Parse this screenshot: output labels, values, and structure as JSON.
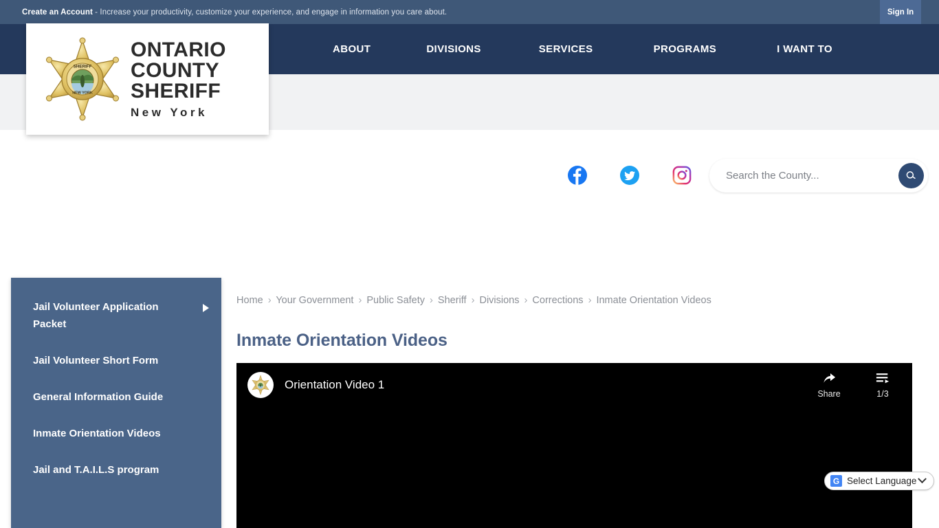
{
  "top_banner": {
    "create_account_label": "Create an Account",
    "tagline": " - Increase your productivity, customize your experience, and engage in information you care about.",
    "sign_in_label": "Sign In",
    "bg_color": "#3f5878",
    "sign_in_bg_color": "#4d6a95"
  },
  "logo": {
    "line1": "ONTARIO",
    "line2": "COUNTY",
    "line3": "SHERIFF",
    "line4": "New York",
    "badge_alt": "sheriff-star-badge",
    "badge_color": "#d9b44a"
  },
  "nav": {
    "bg_color": "#24395c",
    "items": [
      {
        "label": "ABOUT",
        "name": "nav-item-about"
      },
      {
        "label": "DIVISIONS",
        "name": "nav-item-divisions"
      },
      {
        "label": "SERVICES",
        "name": "nav-item-services"
      },
      {
        "label": "PROGRAMS",
        "name": "nav-item-programs"
      },
      {
        "label": "I WANT TO",
        "name": "nav-item-i-want-to"
      }
    ]
  },
  "utility": {
    "bg_color": "#f1f2f3",
    "social": [
      {
        "name": "facebook-icon",
        "label": "Facebook",
        "color": "#1877f2"
      },
      {
        "name": "twitter-icon",
        "label": "Twitter",
        "color": "#1da1f2"
      },
      {
        "name": "instagram-icon",
        "label": "Instagram",
        "color": "#e1306c"
      }
    ],
    "search": {
      "placeholder": "Search the County...",
      "value": "",
      "button_icon": "search-icon",
      "button_color": "#2f4a73"
    }
  },
  "sidebar": {
    "bg_color": "#4a6589",
    "items": [
      {
        "label": "Jail Volunteer Application Packet",
        "has_submenu": true
      },
      {
        "label": "Jail Volunteer Short Form",
        "has_submenu": false
      },
      {
        "label": "General Information Guide",
        "has_submenu": false
      },
      {
        "label": "Inmate Orientation Videos",
        "has_submenu": false
      },
      {
        "label": "Jail and T.A.I.L.S program",
        "has_submenu": false
      }
    ]
  },
  "breadcrumb": [
    "Home",
    "Your Government",
    "Public Safety",
    "Sheriff",
    "Divisions",
    "Corrections",
    "Inmate Orientation Videos"
  ],
  "breadcrumb_separator": "›",
  "main": {
    "page_title": "Inmate Orientation Videos",
    "title_color": "#4b6186"
  },
  "video": {
    "title": "Orientation Video 1",
    "avatar_name": "channel-avatar-sheriff-badge",
    "share_label": "Share",
    "playlist_label": "1/3",
    "background": "#000000"
  },
  "translate": {
    "icon_letter": "G",
    "label": "Select Language",
    "chevron": "chevron-down-icon"
  }
}
